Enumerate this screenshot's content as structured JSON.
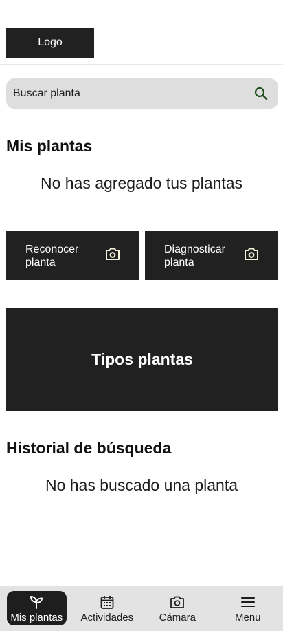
{
  "header": {
    "logo_label": "Logo"
  },
  "search": {
    "placeholder": "Buscar planta",
    "icon": "search-icon"
  },
  "my_plants": {
    "title": "Mis plantas",
    "empty_message": "No has agregado tus plantas"
  },
  "actions": [
    {
      "label": "Reconocer planta",
      "icon": "camera-icon"
    },
    {
      "label": "Diagnosticar planta",
      "icon": "camera-icon"
    }
  ],
  "plant_types": {
    "label": "Tipos plantas"
  },
  "history": {
    "title": "Historial de búsqueda",
    "empty_message": "No has buscado una planta"
  },
  "bottom_nav": {
    "items": [
      {
        "label": "Mis plantas",
        "icon": "sprout-icon",
        "active": true
      },
      {
        "label": "Actividades",
        "icon": "calendar-icon",
        "active": false
      },
      {
        "label": "Cámara",
        "icon": "camera-icon",
        "active": false
      },
      {
        "label": "Menu",
        "icon": "hamburger-menu-icon",
        "active": false
      }
    ]
  },
  "colors": {
    "dark": "#212121",
    "search_bg": "#dedede",
    "nav_bg": "#e3e3e3",
    "search_icon": "#1f4d1f",
    "camera_icon_light": "#f2f2d9"
  }
}
